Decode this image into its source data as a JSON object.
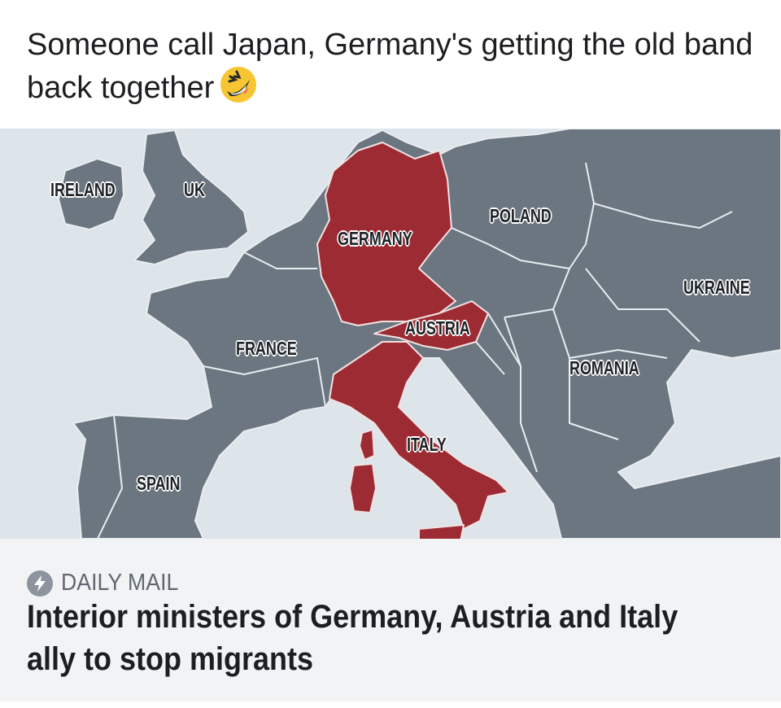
{
  "post": {
    "caption": "Someone call Japan, Germany's getting the old band back together",
    "emoji": "rolling-on-the-floor-laughing-emoji"
  },
  "map": {
    "colors": {
      "sea": "#dde5ea",
      "land": "#6b7680",
      "highlight": "#9c2b33",
      "border": "#ffffff"
    },
    "highlighted": [
      "GERMANY",
      "AUSTRIA",
      "ITALY"
    ],
    "labels": {
      "ireland": "IRELAND",
      "uk": "UK",
      "germany": "GERMANY",
      "poland": "POLAND",
      "ukraine": "UKRAINE",
      "austria": "AUSTRIA",
      "france": "FRANCE",
      "romania": "ROMANIA",
      "italy": "ITALY",
      "spain": "SPAIN"
    }
  },
  "link_preview": {
    "source_icon": "lightning-bolt-icon",
    "source": "DAILY MAIL",
    "headline": "Interior ministers of Germany, Austria and Italy ally to stop migrants"
  }
}
